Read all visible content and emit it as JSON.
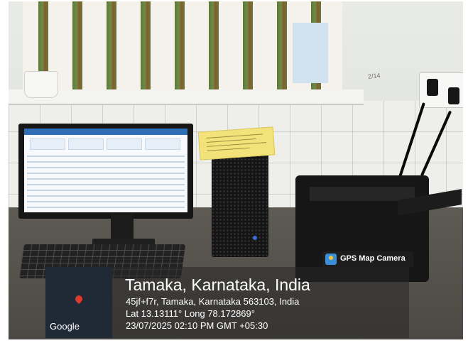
{
  "gps_stamp": {
    "app_name": "GPS Map Camera",
    "app_icon": "gps-map-camera-icon",
    "location_title": "Tamaka, Karnataka, India",
    "address": "45jf+f7r, Tamaka, Karnataka 563103, India",
    "coordinates": "Lat 13.13111° Long 78.172869°",
    "datetime": "23/07/2025 02:10 PM GMT +05:30",
    "map_brand": "Google",
    "map_pin_icon": "map-pin-icon"
  },
  "scene": {
    "wall_label": "2/14"
  },
  "colors": {
    "overlay": "#282828",
    "map_pin": "#e03a2f",
    "paper": "#f3e27a"
  }
}
